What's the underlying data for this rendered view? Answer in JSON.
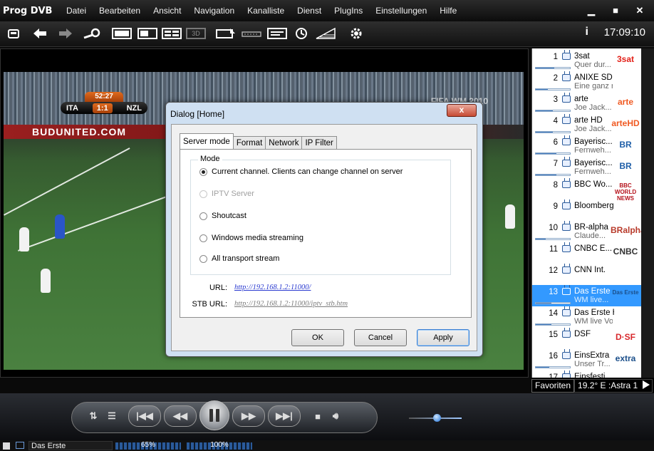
{
  "app": {
    "title": "Prog DVB",
    "time": "17:09:10",
    "info_label": "i"
  },
  "menu": [
    "Datei",
    "Bearbeiten",
    "Ansicht",
    "Navigation",
    "Kanalliste",
    "Dienst",
    "PlugIns",
    "Einstellungen",
    "Hilfe"
  ],
  "window_controls": {
    "minimize": "▁",
    "maximize": "■",
    "close": "✕"
  },
  "toolbar": {
    "icons": [
      "open-icon",
      "back-icon",
      "forward-icon",
      "search-icon",
      "fullscreen-icon",
      "window-icon",
      "multiview-icon",
      "3d-icon",
      "record-icon",
      "timeshift-icon",
      "epg-icon",
      "scheduler-icon",
      "signal-icon",
      "settings-icon"
    ],
    "three_d_label": "3D"
  },
  "video": {
    "score": {
      "time": "52:27",
      "home": "ITA",
      "result": "1:1",
      "away": "NZL"
    },
    "board_text": "BUDUNITED.COM",
    "watermark": "FIFA WM 2010"
  },
  "dialog": {
    "title": "Dialog [Home]",
    "close": "x",
    "tabs": [
      {
        "label": "Server mode",
        "active": true
      },
      {
        "label": "Format",
        "active": false
      },
      {
        "label": "Network",
        "active": false
      },
      {
        "label": "IP Filter",
        "active": false
      }
    ],
    "mode_legend": "Mode",
    "modes": [
      {
        "label": "Current channel. Clients can change channel on server",
        "checked": true,
        "disabled": false
      },
      {
        "label": "IPTV Server",
        "checked": false,
        "disabled": true
      },
      {
        "label": "Shoutcast",
        "checked": false,
        "disabled": false
      },
      {
        "label": "Windows media streaming",
        "checked": false,
        "disabled": false
      },
      {
        "label": "All transport stream",
        "checked": false,
        "disabled": false
      }
    ],
    "url_label": "URL:",
    "url_value": "http://192.168.1.2:11000/",
    "stb_label": "STB URL:",
    "stb_value": "http://192.168.1.2:11000/iptv_stb.htm",
    "buttons": {
      "ok": "OK",
      "cancel": "Cancel",
      "apply": "Apply"
    }
  },
  "channels": [
    {
      "num": "1",
      "name": "3sat",
      "prog": "Quer dur...",
      "logo": "3sat",
      "logo_color": "#e32119",
      "progress": 0.55
    },
    {
      "num": "2",
      "name": "ANIXE SD",
      "prog": "Eine ganz norm...",
      "logo": "",
      "logo_color": "#000000",
      "progress": 0.35
    },
    {
      "num": "3",
      "name": "arte",
      "prog": "Joe Jack...",
      "logo": "arte",
      "logo_color": "#f05a22",
      "progress": 0.5
    },
    {
      "num": "4",
      "name": "arte HD",
      "prog": "Joe Jack...",
      "logo": "arteHD",
      "logo_color": "#f05a22",
      "progress": 0.5
    },
    {
      "num": "6",
      "name": "Bayerisc...",
      "prog": "Fernweh...",
      "logo": "BR",
      "logo_color": "#1f5fa8",
      "progress": 0.6
    },
    {
      "num": "7",
      "name": "Bayerisc...",
      "prog": "Fernweh...",
      "logo": "BR",
      "logo_color": "#1f5fa8",
      "progress": 0.6
    },
    {
      "num": "8",
      "name": "BBC Wo...",
      "prog": "",
      "logo": "BBC WORLD NEWS",
      "logo_color": "#b5121b",
      "progress": 0.0
    },
    {
      "num": "9",
      "name": "Bloomberg Euro...",
      "prog": "",
      "logo": "",
      "logo_color": "#000000",
      "progress": 0.0
    },
    {
      "num": "10",
      "name": "BR-alpha",
      "prog": "Claude...",
      "logo": "BRalpha",
      "logo_color": "#b83a2a",
      "progress": 0.3
    },
    {
      "num": "11",
      "name": "CNBC E...",
      "prog": "",
      "logo": "CNBC",
      "logo_color": "#333333",
      "progress": 0.0
    },
    {
      "num": "12",
      "name": "CNN Int.",
      "prog": "",
      "logo": "",
      "logo_color": "#000000",
      "progress": 0.0
    },
    {
      "num": "13",
      "name": "Das Erste",
      "prog": "WM live...",
      "logo": "Das Erste",
      "logo_color": "#1b4f8a",
      "progress": 0.45,
      "selected": true
    },
    {
      "num": "14",
      "name": "Das Erste HD",
      "prog": "WM live Vorrund...",
      "logo": "",
      "logo_color": "#000000",
      "progress": 0.45
    },
    {
      "num": "15",
      "name": "DSF",
      "prog": "",
      "logo": "D·SF",
      "logo_color": "#d8282c",
      "progress": 0.0
    },
    {
      "num": "16",
      "name": "EinsExtra",
      "prog": "Unser Tr...",
      "logo": "extra",
      "logo_color": "#1b4f8a",
      "progress": 0.4
    },
    {
      "num": "17",
      "name": "Einsfesti...",
      "prog": "",
      "logo": "",
      "logo_color": "#000000",
      "progress": 0.0
    }
  ],
  "channel_footer": {
    "favorites": "Favoriten",
    "satellite": "19.2° E :Astra 1"
  },
  "transport": {
    "buttons": [
      "audio-mix-icon",
      "list-icon",
      "skip-back-icon",
      "rewind-icon",
      "pause-icon",
      "fast-forward-icon",
      "skip-forward-icon",
      "stop-icon",
      "volume-icon"
    ],
    "volume": 0.48
  },
  "status": {
    "channel": "Das Erste",
    "signal_level": "65%",
    "signal_quality": "100%"
  }
}
